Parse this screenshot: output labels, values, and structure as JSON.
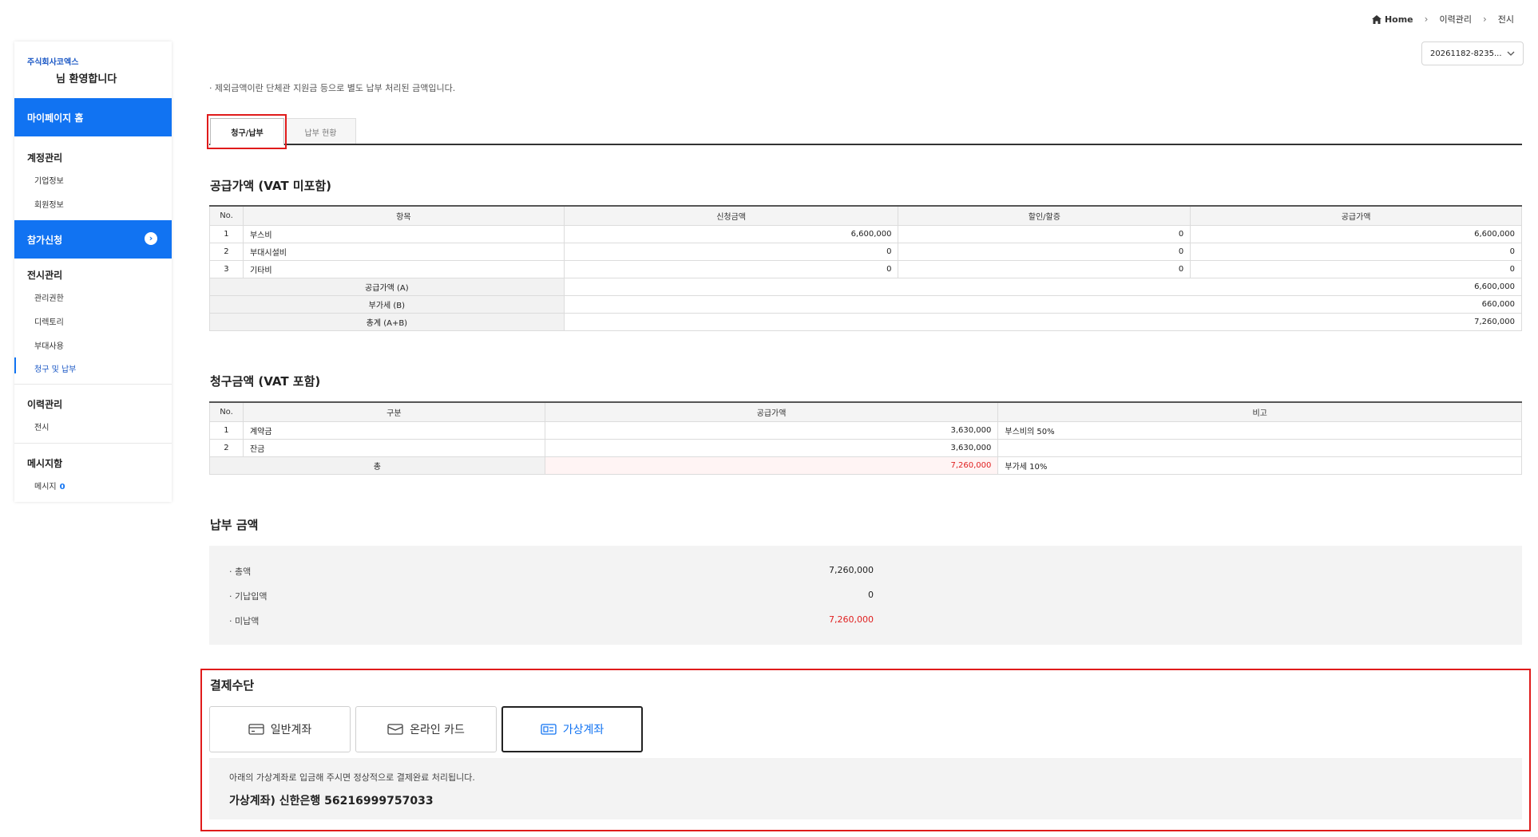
{
  "breadcrumb": {
    "home": "Home",
    "level1": "이력관리",
    "level2": "전시"
  },
  "select_value": "20261182-8235...",
  "sidebar": {
    "company": "주식회사코엑스",
    "welcome": "님 환영합니다",
    "mypage_home": "마이페이지 홈",
    "account_head": "계정관리",
    "account_items": [
      "기업정보",
      "회원정보"
    ],
    "apply": "참가신청",
    "exhibit_head": "전시관리",
    "exhibit_items": [
      "관리권한",
      "디렉토리",
      "부대사용",
      "청구 및 납부"
    ],
    "history_head": "이력관리",
    "history_items": [
      "전시"
    ],
    "message_head": "메시지함",
    "message_item": "메시지",
    "message_count": "0"
  },
  "notice": "· 제외금액이란 단체관 지원금 등으로 별도 납부 처리된 금액입니다.",
  "tabs": [
    "청구/납부",
    "납부 현황"
  ],
  "supply": {
    "title": "공급가액 (VAT 미포함)",
    "headers": [
      "No.",
      "항목",
      "신청금액",
      "할인/할증",
      "공급가액"
    ],
    "rows": [
      [
        "1",
        "부스비",
        "6,600,000",
        "0",
        "6,600,000"
      ],
      [
        "2",
        "부대시설비",
        "0",
        "0",
        "0"
      ],
      [
        "3",
        "기타비",
        "0",
        "0",
        "0"
      ]
    ],
    "sums": [
      {
        "label": "공급가액 (A)",
        "value": "6,600,000"
      },
      {
        "label": "부가세 (B)",
        "value": "660,000"
      },
      {
        "label": "총계 (A+B)",
        "value": "7,260,000"
      }
    ]
  },
  "billing": {
    "title": "청구금액 (VAT 포함)",
    "headers": [
      "No.",
      "구분",
      "공급가액",
      "비고"
    ],
    "rows": [
      [
        "1",
        "계약금",
        "3,630,000",
        "부스비의 50%"
      ],
      [
        "2",
        "잔금",
        "3,630,000",
        ""
      ]
    ],
    "total": {
      "label": "총",
      "value": "7,260,000",
      "note": "부가세 10%"
    }
  },
  "payment": {
    "title": "납부 금액",
    "rows": [
      {
        "label": "· 총액",
        "value": "7,260,000"
      },
      {
        "label": "· 기납입액",
        "value": "0"
      },
      {
        "label": "· 미납액",
        "value": "7,260,000"
      }
    ]
  },
  "method": {
    "title": "결제수단",
    "options": [
      "일반계좌",
      "온라인 카드",
      "가상계좌"
    ],
    "selected": "가상계좌",
    "description": "아래의 가상계좌로 입금해 주시면 정상적으로 결제완료 처리됩니다.",
    "account": "가상계좌) 신한은행 56216999757033"
  },
  "colors": {
    "accent": "#1173f2",
    "highlight": "#e01b1b",
    "negative": "#e02020"
  }
}
